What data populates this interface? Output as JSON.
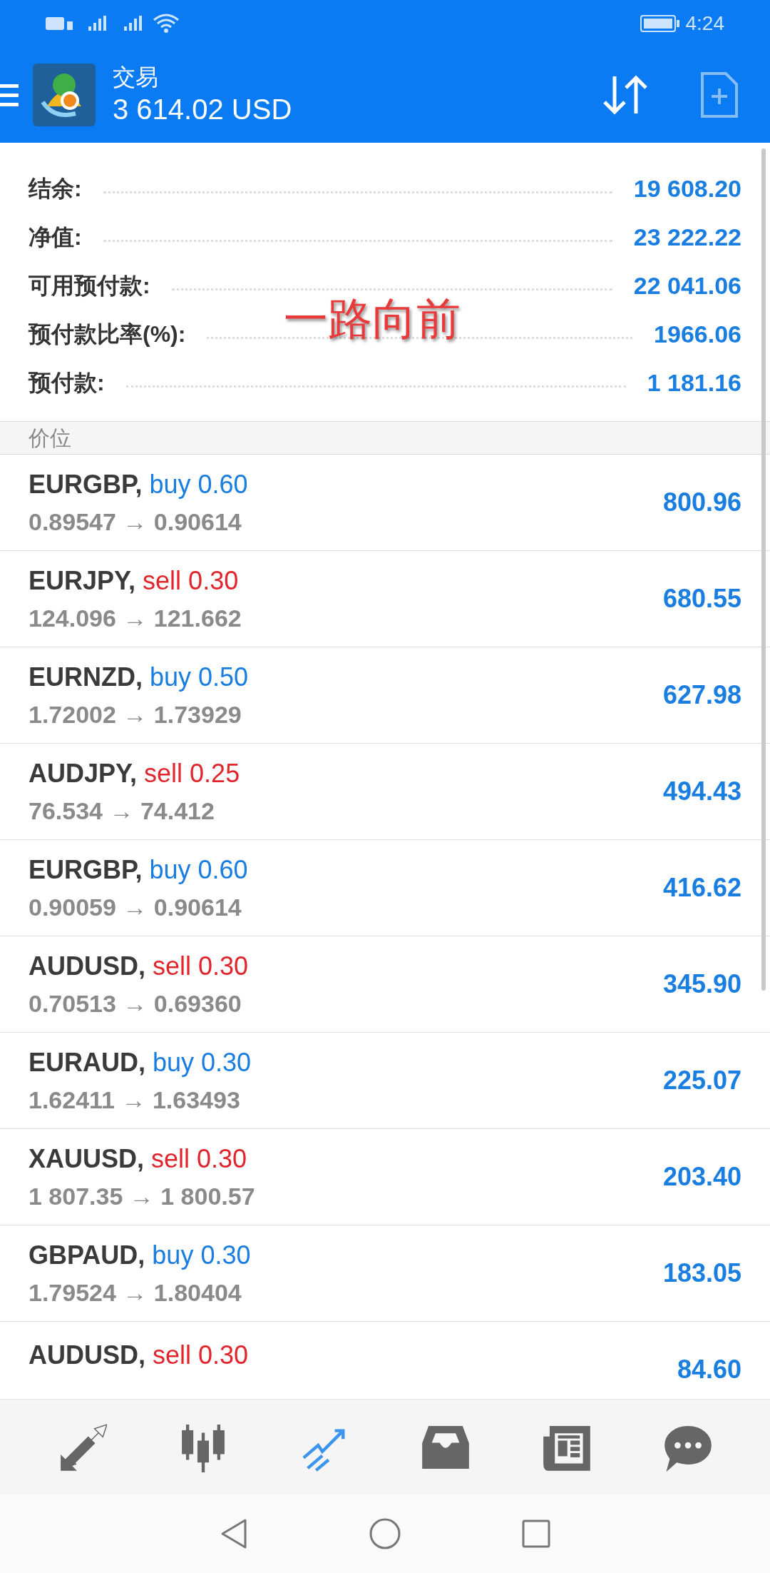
{
  "status_bar": {
    "time": "4:24"
  },
  "header": {
    "title": "交易",
    "profit": "3 614.02 USD"
  },
  "summary": [
    {
      "label": "结余:",
      "value": "19 608.20"
    },
    {
      "label": "净值:",
      "value": "23 222.22"
    },
    {
      "label": "可用预付款:",
      "value": "22 041.06"
    },
    {
      "label": "预付款比率(%):",
      "value": "1966.06"
    },
    {
      "label": "预付款:",
      "value": "1 181.16"
    }
  ],
  "overlay_caption": "一路向前",
  "section_title": "价位",
  "positions": [
    {
      "symbol": "EURGBP,",
      "side": "buy",
      "volume": "0.60",
      "prices": "0.89547 → 0.90614",
      "profit": "800.96"
    },
    {
      "symbol": "EURJPY,",
      "side": "sell",
      "volume": "0.30",
      "prices": "124.096 → 121.662",
      "profit": "680.55"
    },
    {
      "symbol": "EURNZD,",
      "side": "buy",
      "volume": "0.50",
      "prices": "1.72002 → 1.73929",
      "profit": "627.98"
    },
    {
      "symbol": "AUDJPY,",
      "side": "sell",
      "volume": "0.25",
      "prices": "76.534 → 74.412",
      "profit": "494.43"
    },
    {
      "symbol": "EURGBP,",
      "side": "buy",
      "volume": "0.60",
      "prices": "0.90059 → 0.90614",
      "profit": "416.62"
    },
    {
      "symbol": "AUDUSD,",
      "side": "sell",
      "volume": "0.30",
      "prices": "0.70513 → 0.69360",
      "profit": "345.90"
    },
    {
      "symbol": "EURAUD,",
      "side": "buy",
      "volume": "0.30",
      "prices": "1.62411 → 1.63493",
      "profit": "225.07"
    },
    {
      "symbol": "XAUUSD,",
      "side": "sell",
      "volume": "0.30",
      "prices": "1 807.35 → 1 800.57",
      "profit": "203.40"
    },
    {
      "symbol": "GBPAUD,",
      "side": "buy",
      "volume": "0.30",
      "prices": "1.79524 → 1.80404",
      "profit": "183.05"
    },
    {
      "symbol": "AUDUSD,",
      "side": "sell",
      "volume": "0.30",
      "profit": "84.60"
    }
  ],
  "bottom_nav": [
    {
      "selected": false
    },
    {
      "selected": false
    },
    {
      "selected": true
    },
    {
      "selected": false
    },
    {
      "selected": false
    },
    {
      "selected": false
    }
  ]
}
